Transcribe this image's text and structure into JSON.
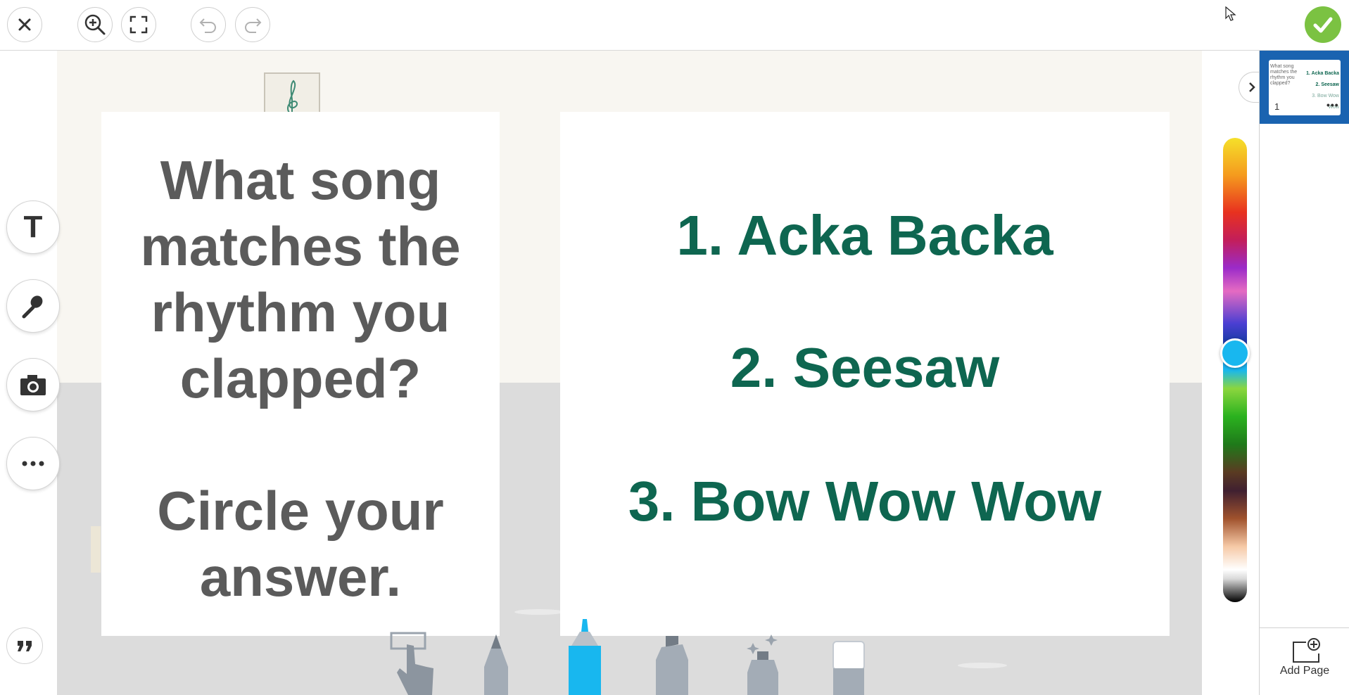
{
  "toolbar": {
    "close_icon": "close-icon",
    "zoom_icon": "zoom-in-icon",
    "fullscreen_icon": "fullscreen-icon",
    "undo_icon": "undo-icon",
    "redo_icon": "redo-icon",
    "done_icon": "checkmark-icon",
    "done_color": "#7bc242"
  },
  "canvas": {
    "question_lines": [
      "What song",
      "matches the",
      "rhythm you",
      "clapped?",
      "Circle your",
      "answer."
    ],
    "answers": [
      "1. Acka Backa",
      "2. Seesaw",
      "3. Bow Wow Wow"
    ],
    "question_color": "#5b5b5b",
    "answer_color": "#0e6650"
  },
  "left_tools": [
    "text-tool",
    "microphone-tool",
    "camera-tool",
    "more-tools"
  ],
  "text_tool_glyph": "T",
  "palette": {
    "selected_color": "#18b7ef"
  },
  "drawing_tools": [
    "move-hand-tool",
    "pencil-tool",
    "marker-tool",
    "highlighter-tool",
    "glitter-tool",
    "eraser-tool"
  ],
  "pages": {
    "thumbnail": {
      "number": "1",
      "question": "What song matches the rhythm you clapped?",
      "answers": [
        "1. Acka Backa",
        "2. Seesaw",
        "3. Bow Wow Wow"
      ],
      "more": "•••"
    },
    "add_page_label": "Add Page"
  }
}
